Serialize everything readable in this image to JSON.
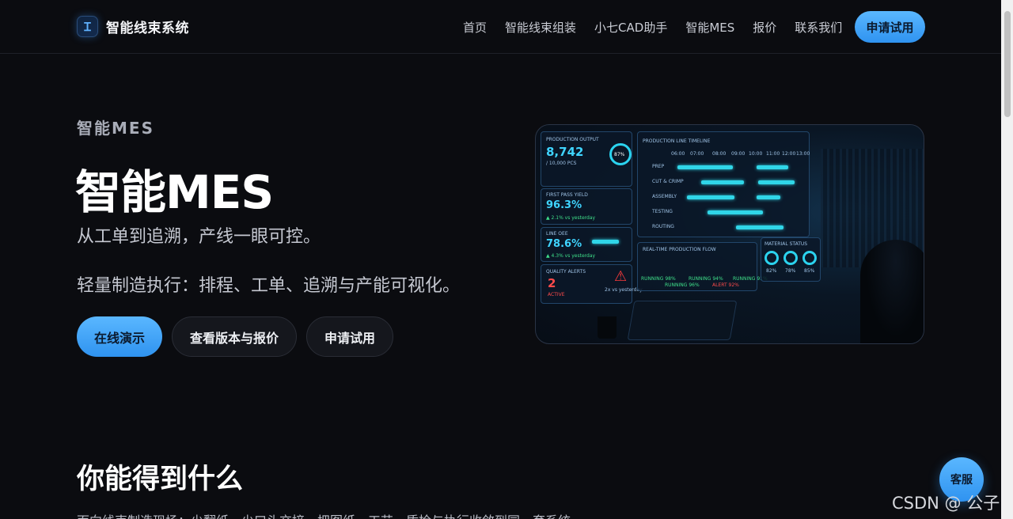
{
  "header": {
    "brand_name": "智能线束系统",
    "logo_glyph": "Ɪ",
    "menu": [
      "首页",
      "智能线束组装",
      "小七CAD助手",
      "智能MES",
      "报价",
      "联系我们"
    ],
    "cta_label": "申请试用"
  },
  "hero": {
    "eyebrow": "智能MES",
    "title": "智能MES",
    "subtitle": "从工单到追溯，产线一眼可控。",
    "description": "轻量制造执行：排程、工单、追溯与产能可视化。",
    "buttons": [
      "在线演示",
      "查看版本与报价",
      "申请试用"
    ]
  },
  "dashboard": {
    "output_label": "PRODUCTION OUTPUT",
    "output_value": "8,742",
    "output_target": "/ 10,000 PCS",
    "output_pct": "87%",
    "yield_label": "FIRST PASS YIELD",
    "yield_value": "96.3%",
    "yield_delta": "▲ 2.1% vs yesterday",
    "oee_label": "LINE OEE",
    "oee_value": "78.6%",
    "oee_delta": "▲ 4.3% vs yesterday",
    "alerts_label": "QUALITY ALERTS",
    "alerts_value": "2",
    "alerts_state": "ACTIVE",
    "alerts_note": "2x vs yesterday",
    "timeline_label": "PRODUCTION LINE TIMELINE",
    "timeline_hours": [
      "06:00",
      "07:00",
      "08:00",
      "09:00",
      "10:00",
      "11:00",
      "12:00",
      "13:00"
    ],
    "timeline_rows": [
      "PREP",
      "CUT & CRIMP",
      "ASSEMBLY",
      "TESTING",
      "ROUTING"
    ],
    "flow_label": "REAL-TIME PRODUCTION FLOW",
    "flow_states": [
      "RUNNING 98%",
      "RUNNING 96%",
      "RUNNING 94%",
      "ALERT 92%",
      "RUNNING 91%"
    ],
    "material_label": "MATERIAL STATUS",
    "material_values": [
      "82%",
      "78%",
      "85%"
    ]
  },
  "section": {
    "title": "你能得到什么",
    "text": "面向线束制造现场：少翻纸、少口头交接、把图纸、工艺、质检与执行收敛到同一套系统。"
  },
  "float": {
    "chat_label": "客服",
    "watermark": "CSDN @ 公子"
  }
}
